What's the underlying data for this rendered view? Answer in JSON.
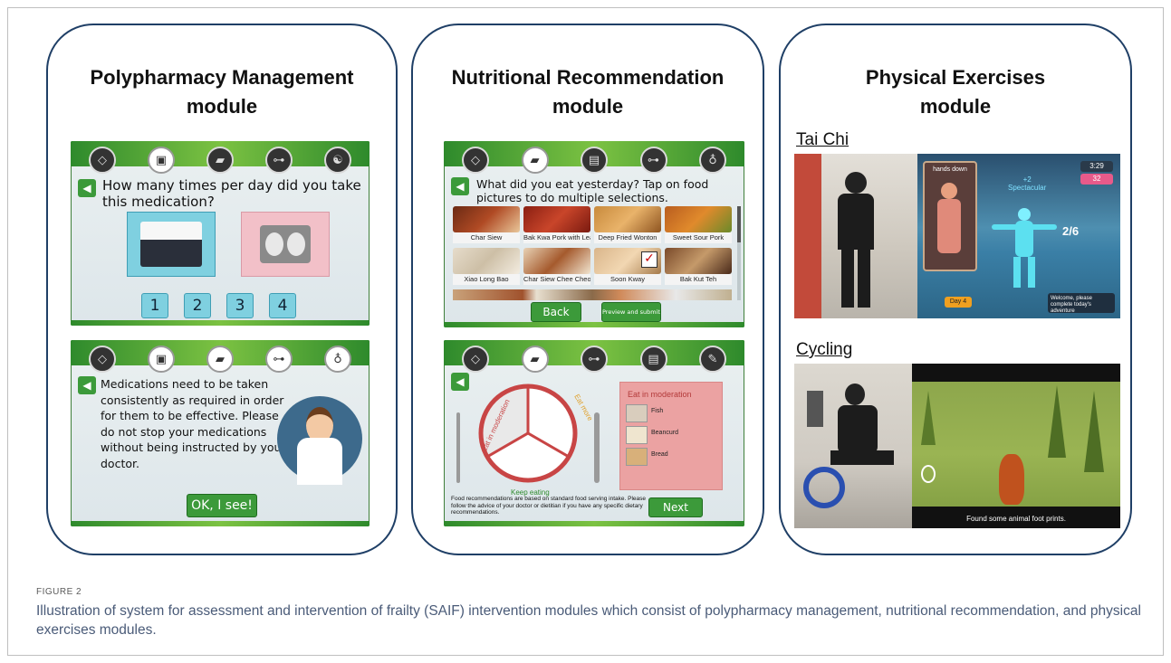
{
  "panels": {
    "polypharmacy": {
      "title": "Polypharmacy Management\nmodule",
      "screen1": {
        "question": "How many times per day did you take this medication?",
        "answers": [
          "1",
          "2",
          "3",
          "4"
        ]
      },
      "screen2": {
        "message": "Medications need to be taken consistently as required in order for them to be effective. Please do not stop your medications without being instructed by your doctor.",
        "button": "OK, I see!"
      }
    },
    "nutrition": {
      "title": "Nutritional Recommendation\nmodule",
      "screen1": {
        "question": "What did you eat yesterday? Tap on food pictures to do multiple selections.",
        "foods": [
          "Char Siew",
          "Bak Kwa Pork with Lean Am",
          "Deep Fried Wonton",
          "Sweet Sour Pork",
          "Xiao Long Bao",
          "Char Siew Chee Cheong Fu",
          "Soon Kway",
          "Bak Kut Teh"
        ],
        "back_button": "Back",
        "submit_button": "Preview and submit"
      },
      "screen2": {
        "pie_labels": [
          "Eat in moderation",
          "Eat more",
          "Keep eating"
        ],
        "list_title": "Eat in moderation",
        "list_items": [
          "Fish",
          "Beancurd",
          "Bread"
        ],
        "footnote": "Food recommendations are based on standard food serving intake. Please follow the advice of your doctor or dietitian if you have any specific dietary recommendations.",
        "next_button": "Next"
      }
    },
    "exercise": {
      "title": "Physical Exercises\nmodule",
      "taichi": {
        "label": "Tai Chi",
        "game_pose": "hands down",
        "game_time": "3:29",
        "game_score": "32",
        "game_feedback": "+2\nSpectacular",
        "game_progress": "2/6",
        "game_day": "Day 4",
        "game_welcome": "Welcome, please complete today's adventure"
      },
      "cycling": {
        "label": "Cycling",
        "game_message": "Found some animal foot prints."
      }
    }
  },
  "caption": {
    "label": "FIGURE 2",
    "text": "Illustration of system for assessment and intervention of frailty (SAIF) intervention modules which consist of polypharmacy management, nutritional recommendation, and physical exercises modules."
  },
  "colors": {
    "panel_border": "#1f3f66",
    "green": "#3c9a3a",
    "caption_text": "#4a5b78"
  }
}
